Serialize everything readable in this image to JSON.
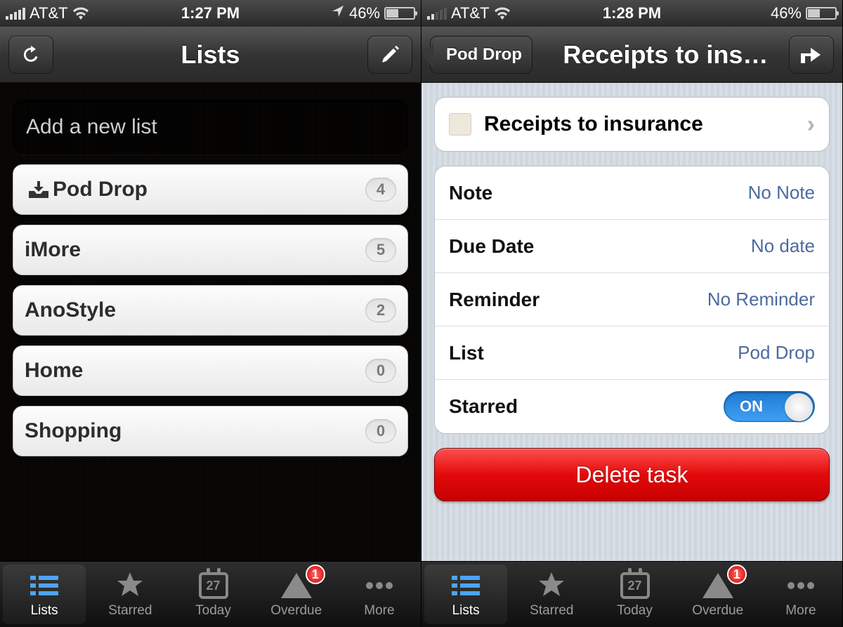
{
  "left": {
    "status": {
      "carrier": "AT&T",
      "time": "1:27 PM",
      "battery": "46%",
      "location_icon": true
    },
    "nav": {
      "title": "Lists"
    },
    "add_placeholder": "Add a new list",
    "lists": [
      {
        "name": "Pod Drop",
        "count": "4",
        "inbox": true
      },
      {
        "name": "iMore",
        "count": "5"
      },
      {
        "name": "AnoStyle",
        "count": "2"
      },
      {
        "name": "Home",
        "count": "0"
      },
      {
        "name": "Shopping",
        "count": "0"
      }
    ]
  },
  "right": {
    "status": {
      "carrier": "AT&T",
      "time": "1:28 PM",
      "battery": "46%"
    },
    "nav": {
      "back": "Pod Drop",
      "title": "Receipts to ins…"
    },
    "task_title": "Receipts to insurance",
    "fields": {
      "note": {
        "label": "Note",
        "value": "No Note"
      },
      "due": {
        "label": "Due Date",
        "value": "No date"
      },
      "reminder": {
        "label": "Reminder",
        "value": "No Reminder"
      },
      "list": {
        "label": "List",
        "value": "Pod Drop"
      },
      "starred": {
        "label": "Starred",
        "toggle": "ON"
      }
    },
    "delete": "Delete task"
  },
  "tabs": {
    "items": [
      {
        "label": "Lists"
      },
      {
        "label": "Starred"
      },
      {
        "label": "Today",
        "calendar": "27"
      },
      {
        "label": "Overdue",
        "badge": "1"
      },
      {
        "label": "More"
      }
    ]
  }
}
